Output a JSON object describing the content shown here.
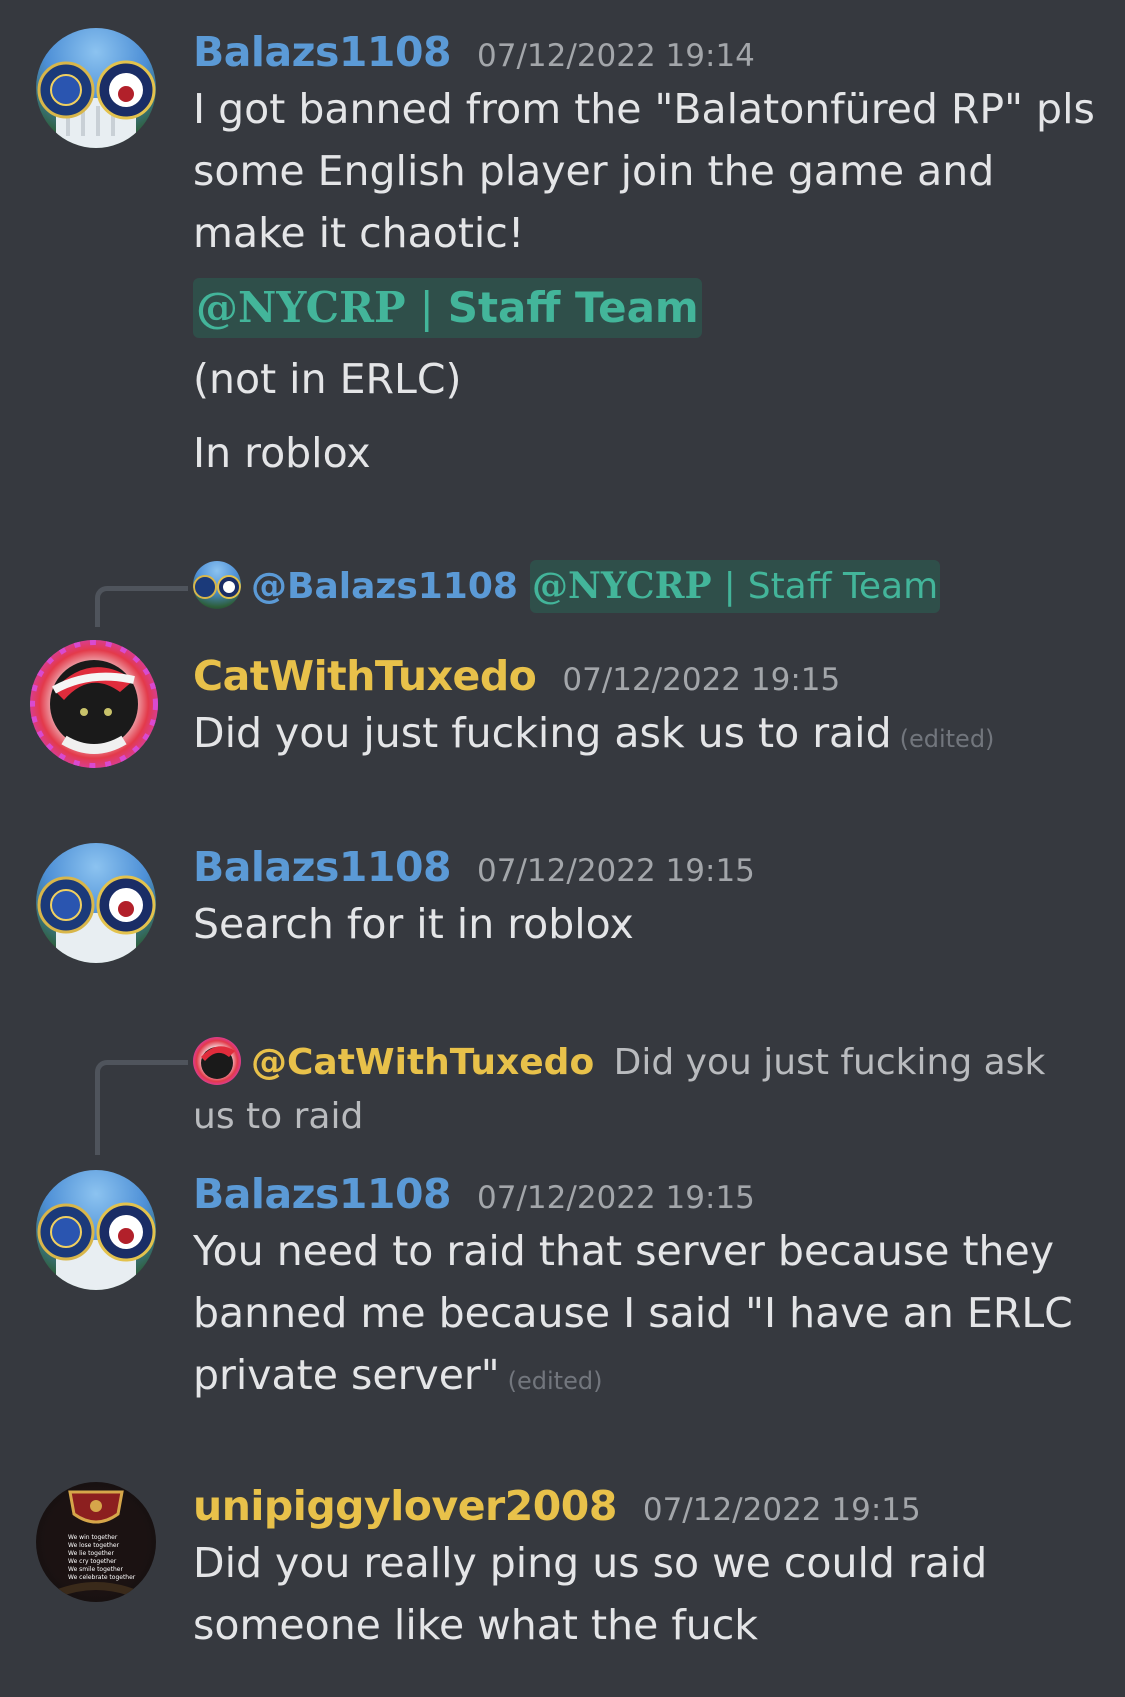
{
  "colors": {
    "background": "#36393f",
    "username_blue": "#5b9ad6",
    "username_yellow": "#e8c14a",
    "mention_bg": "#2f4f4a",
    "mention_text": "#43b59a",
    "timestamp": "#a3a6aa"
  },
  "messages": [
    {
      "author": "Balazs1108",
      "timestamp": "07/12/2022 19:14",
      "avatar": "fbi-cia-seals-avatar",
      "lines": [
        "I got banned from the \"Balatonfüred RP\" pls some English player join the game and make it chaotic!",
        "(not in ERLC)",
        "In roblox"
      ],
      "mention": {
        "org": "@NYCRP",
        "role": "Staff Team"
      }
    },
    {
      "reply_to": {
        "author": "@Balazs1108",
        "mention_org": "@NYCRP",
        "mention_role": "Staff Team"
      },
      "author": "CatWithTuxedo",
      "timestamp": "07/12/2022 19:15",
      "avatar": "cat-santa-hat-avatar",
      "text": "Did you just fucking ask us to raid",
      "edited": "(edited)"
    },
    {
      "author": "Balazs1108",
      "timestamp": "07/12/2022 19:15",
      "avatar": "fbi-cia-seals-avatar",
      "text": "Search for it in roblox"
    },
    {
      "reply_to": {
        "author": "@CatWithTuxedo",
        "text": "Did you just fucking ask us to raid"
      },
      "author": "Balazs1108",
      "timestamp": "07/12/2022 19:15",
      "avatar": "fbi-cia-seals-avatar",
      "text": "You need to raid that server because they banned me because I said \"I have an ERLC private server\"",
      "edited": "(edited)"
    },
    {
      "author": "unipiggylover2008",
      "timestamp": "07/12/2022 19:15",
      "avatar": "crest-avatar",
      "avatar_text": [
        "We win together",
        "We lose together",
        "We lie together",
        "We cry together",
        "We smile together",
        "We celebrate together"
      ],
      "text": "Did you really ping us so we could raid someone like what the fuck"
    }
  ]
}
